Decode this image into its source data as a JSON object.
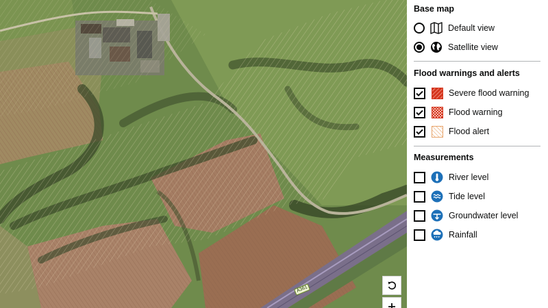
{
  "map": {
    "road_label": "A361",
    "controls": {
      "reset_icon": "reset-rotation-icon",
      "zoom_in_icon": "plus-icon"
    }
  },
  "panel": {
    "base_map": {
      "title": "Base map",
      "options": [
        {
          "label": "Default view",
          "selected": false,
          "icon": "folded-map-icon"
        },
        {
          "label": "Satellite view",
          "selected": true,
          "icon": "globe-icon"
        }
      ]
    },
    "warnings": {
      "title": "Flood warnings and alerts",
      "items": [
        {
          "label": "Severe flood warning",
          "checked": true,
          "color": "#d4351c"
        },
        {
          "label": "Flood warning",
          "checked": true,
          "color": "#d4351c"
        },
        {
          "label": "Flood alert",
          "checked": true,
          "color": "#e8a46a"
        }
      ]
    },
    "measurements": {
      "title": "Measurements",
      "items": [
        {
          "label": "River level",
          "checked": false,
          "icon": "river-level-icon",
          "color": "#1d70b8"
        },
        {
          "label": "Tide level",
          "checked": false,
          "icon": "tide-level-icon",
          "color": "#1d70b8"
        },
        {
          "label": "Groundwater level",
          "checked": false,
          "icon": "groundwater-level-icon",
          "color": "#1d70b8"
        },
        {
          "label": "Rainfall",
          "checked": false,
          "icon": "rainfall-icon",
          "color": "#1d70b8"
        }
      ]
    }
  }
}
